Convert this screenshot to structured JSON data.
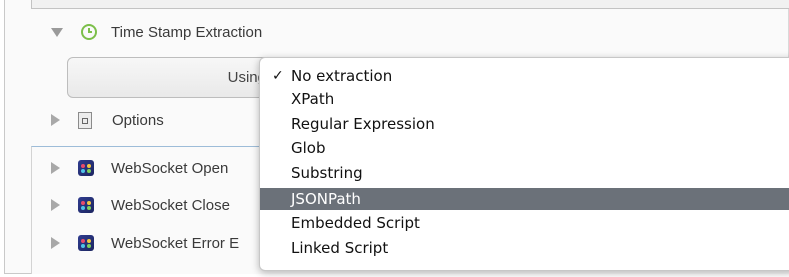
{
  "timestamp_section": {
    "title": "Time Stamp Extraction",
    "using_label": "Using"
  },
  "options_row": {
    "label": "Options"
  },
  "websocket_rows": [
    {
      "label": "WebSocket Open"
    },
    {
      "label": "WebSocket Close"
    },
    {
      "label": "WebSocket Error E"
    }
  ],
  "extraction_menu": {
    "check_glyph": "✓",
    "items": [
      {
        "label": "No extraction",
        "checked": true
      },
      {
        "label": "XPath"
      },
      {
        "label": "Regular Expression"
      },
      {
        "label": "Glob"
      },
      {
        "label": "Substring"
      },
      {
        "label": "JSONPath",
        "highlighted": true
      },
      {
        "label": "Embedded Script"
      },
      {
        "label": "Linked Script"
      }
    ],
    "highlight_color": "#6b7179"
  },
  "icons": {
    "timestamp": "clock-icon",
    "options": "document-icon",
    "websocket": "websocket-icon"
  }
}
